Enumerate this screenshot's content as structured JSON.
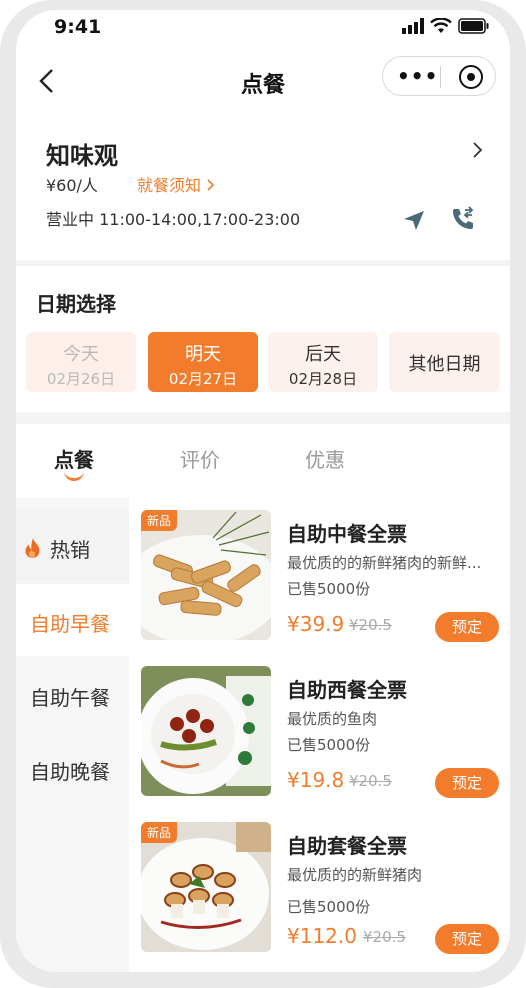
{
  "status": {
    "time": "9:41"
  },
  "nav": {
    "title": "点餐"
  },
  "shop": {
    "name": "知味观",
    "price": "¥60/人",
    "notice": "就餐须知",
    "hours": "营业中  11:00-14:00,17:00-23:00"
  },
  "dates": {
    "title": "日期选择",
    "items": [
      {
        "label": "今天",
        "date": "02月26日"
      },
      {
        "label": "明天",
        "date": "02月27日"
      },
      {
        "label": "后天",
        "date": "02月28日"
      },
      {
        "label": "其他日期",
        "date": ""
      }
    ]
  },
  "tabs": [
    "点餐",
    "评价",
    "优惠"
  ],
  "sidebar": [
    "热销",
    "自助早餐",
    "自助午餐",
    "自助晚餐"
  ],
  "products": [
    {
      "tag": "新品",
      "name": "自助中餐全票",
      "desc": "最优质的的新鲜猪肉的新鲜...",
      "sold": "已售5000份",
      "price": "¥39.9",
      "orig": "¥20.5",
      "btn": "预定"
    },
    {
      "tag": "",
      "name": "自助西餐全票",
      "desc": "最优质的鱼肉",
      "sold": "已售5000份",
      "price": "¥19.8",
      "orig": "¥20.5",
      "btn": "预定"
    },
    {
      "tag": "新品",
      "name": "自助套餐全票",
      "desc": "最优质的的新鲜猪肉",
      "sold": "已售5000份",
      "price": "¥112.0",
      "orig": "¥20.5",
      "btn": "预定"
    }
  ],
  "colors": {
    "accent": "#f37c2c"
  }
}
